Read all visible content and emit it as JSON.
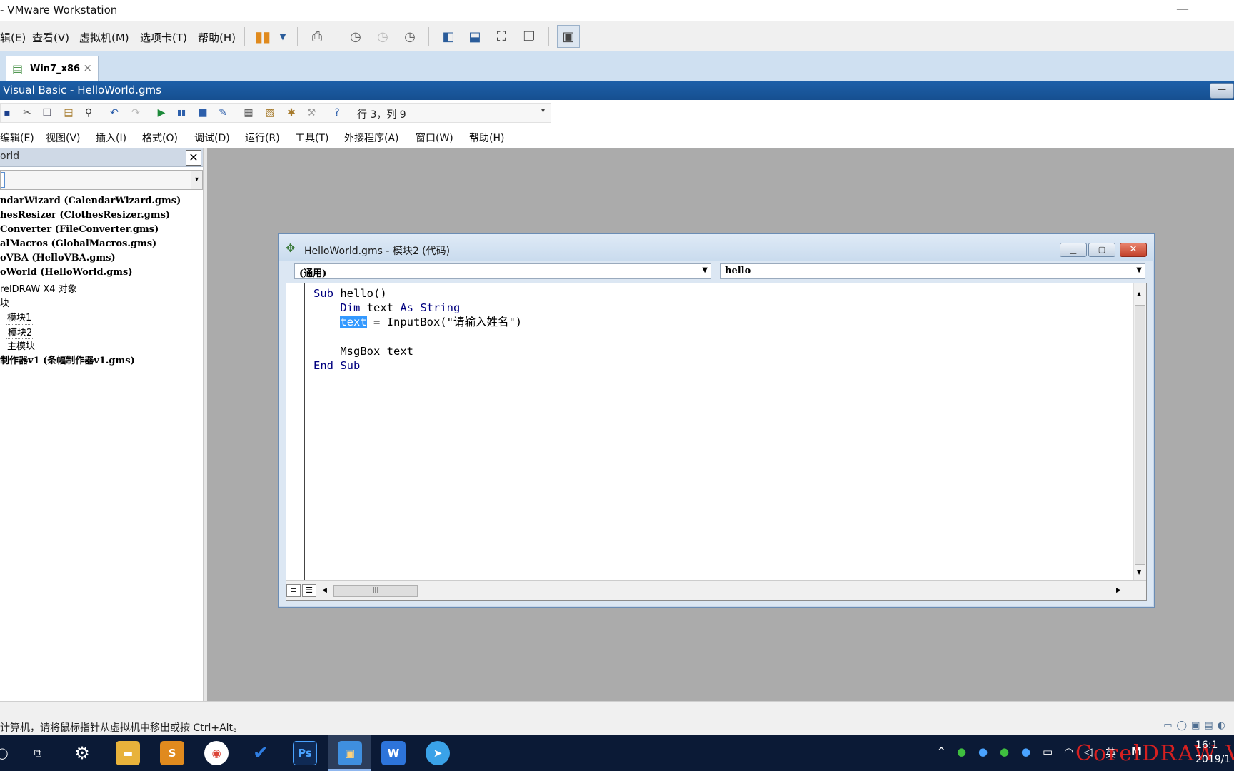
{
  "vmware": {
    "title": "- VMware Workstation",
    "min_glyph": "—",
    "menu": [
      "辑(E)",
      "查看(V)",
      "虚拟机(M)",
      "选项卡(T)",
      "帮助(H)"
    ],
    "tab_label": "Win7_x86",
    "tab_close": "×"
  },
  "vba": {
    "title": "Visual Basic - HelloWorld.gms",
    "cursor_position": "行 3，列 9",
    "menu": [
      "编辑(E)",
      "视图(V)",
      "插入(I)",
      "格式(O)",
      "调试(D)",
      "运行(R)",
      "工具(T)",
      "外接程序(A)",
      "窗口(W)",
      "帮助(H)"
    ]
  },
  "project": {
    "header": "orld",
    "close": "✕",
    "tree": [
      {
        "label": "ndarWizard (CalendarWizard.gms)",
        "bold": true
      },
      {
        "label": "hesResizer (ClothesResizer.gms)",
        "bold": true
      },
      {
        "label": "Converter (FileConverter.gms)",
        "bold": true
      },
      {
        "label": "alMacros (GlobalMacros.gms)",
        "bold": true
      },
      {
        "label": "oVBA (HelloVBA.gms)",
        "bold": true
      },
      {
        "label": "oWorld (HelloWorld.gms)",
        "bold": true
      },
      {
        "label": "relDRAW X4 对象",
        "bold": false
      },
      {
        "label": "块",
        "bold": false
      },
      {
        "label": "模块1",
        "bold": false
      },
      {
        "label": "模块2",
        "bold": false
      },
      {
        "label": "主模块",
        "bold": false
      },
      {
        "label": "制作器v1 (条幅制作器v1.gms)",
        "bold": true
      }
    ]
  },
  "code_window": {
    "title": "HelloWorld.gms - 模块2 (代码)",
    "object_combo": "(通用)",
    "proc_combo": "hello",
    "lines": {
      "l1_kw": "Sub",
      "l1_rest": " hello()",
      "l2_indent": "    ",
      "l2_kw1": "Dim",
      "l2_mid": " text ",
      "l2_kw2": "As String",
      "l3_indent": "    ",
      "l3_sel": "text",
      "l3_rest": " = InputBox(\"请输入姓名\")",
      "l5": "    MsgBox text",
      "l6_kw1": "End",
      "l6_sp": " ",
      "l6_kw2": "Sub"
    }
  },
  "status": {
    "message": "计算机，请将鼠标指针从虚拟机中移出或按 Ctrl+Alt。"
  },
  "taskbar": {
    "watermark": "CorelDRAW VBA",
    "time": "16:1",
    "date": "2019/1",
    "ime": "英",
    "ime2": "M"
  },
  "colors": {
    "vba_titlebar": "#1d5fa8",
    "selection": "#3399ff",
    "keyword": "#00007f",
    "taskbar": "#0b1a36"
  }
}
